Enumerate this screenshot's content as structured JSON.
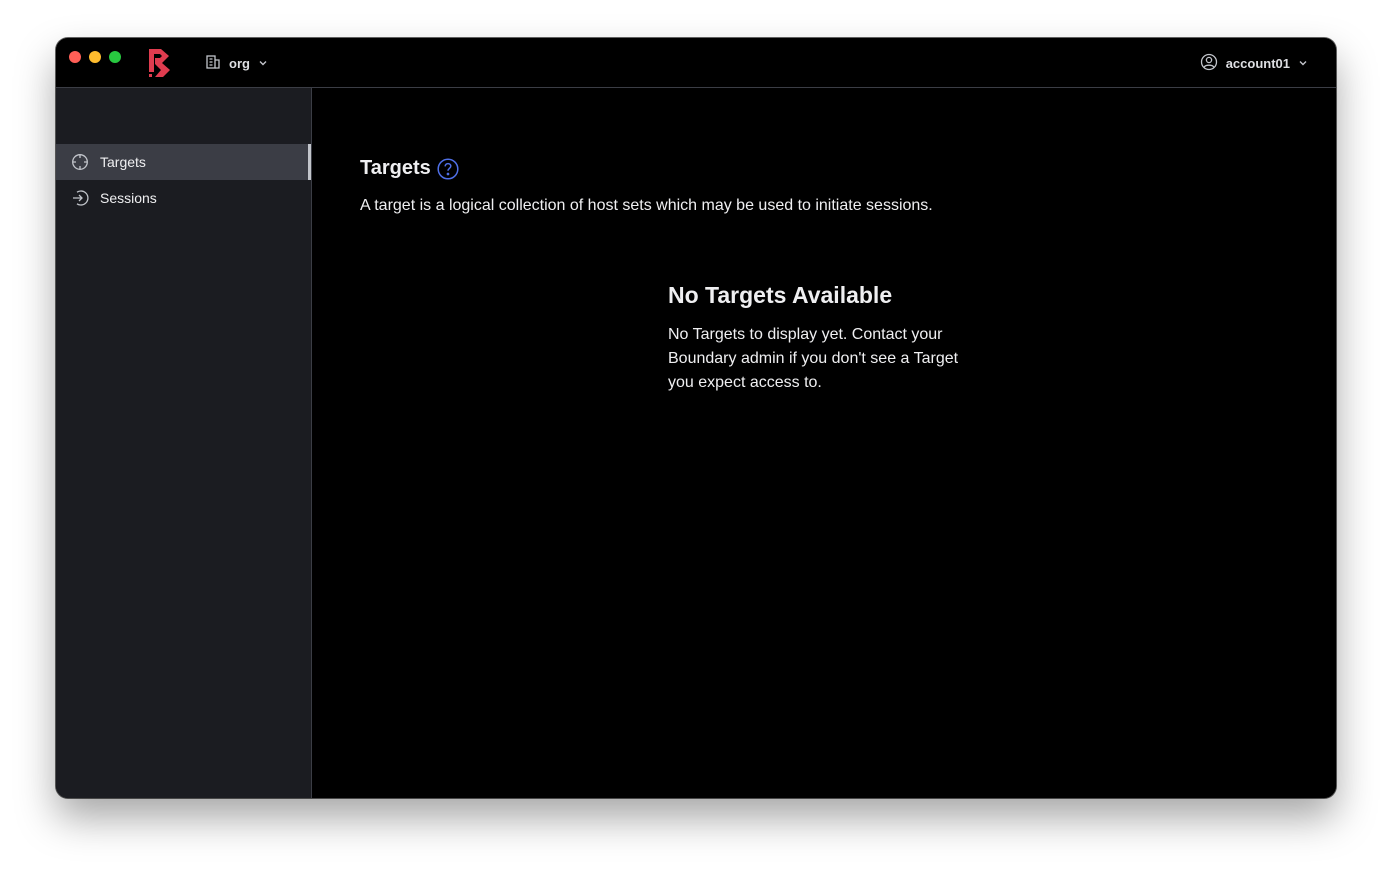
{
  "window": {
    "traffic_lights": [
      "close",
      "minimize",
      "zoom"
    ]
  },
  "header": {
    "logo_icon": "boundary-logo",
    "org_switcher": {
      "icon": "building-icon",
      "label": "org",
      "chevron": "chevron-down-icon"
    },
    "user_menu": {
      "icon": "user-circle-icon",
      "label": "account01",
      "chevron": "chevron-down-icon"
    }
  },
  "sidebar": {
    "items": [
      {
        "label": "Targets",
        "icon": "crosshair-icon",
        "active": true
      },
      {
        "label": "Sessions",
        "icon": "entry-icon",
        "active": false
      }
    ]
  },
  "main": {
    "title": "Targets",
    "help_icon": "help-circle-icon",
    "description": "A target is a logical collection of host sets which may be used to initiate sessions.",
    "empty_state": {
      "heading": "No Targets Available",
      "message": "No Targets to display yet. Contact your Boundary admin if you don't see a Target you expect access to."
    }
  },
  "colors": {
    "background": "#000000",
    "sidebar": "#1b1c21",
    "active_item": "#3b3d45",
    "brand": "#e03c4f",
    "help_accent": "#4f6fe6",
    "text": "#efeff1"
  }
}
